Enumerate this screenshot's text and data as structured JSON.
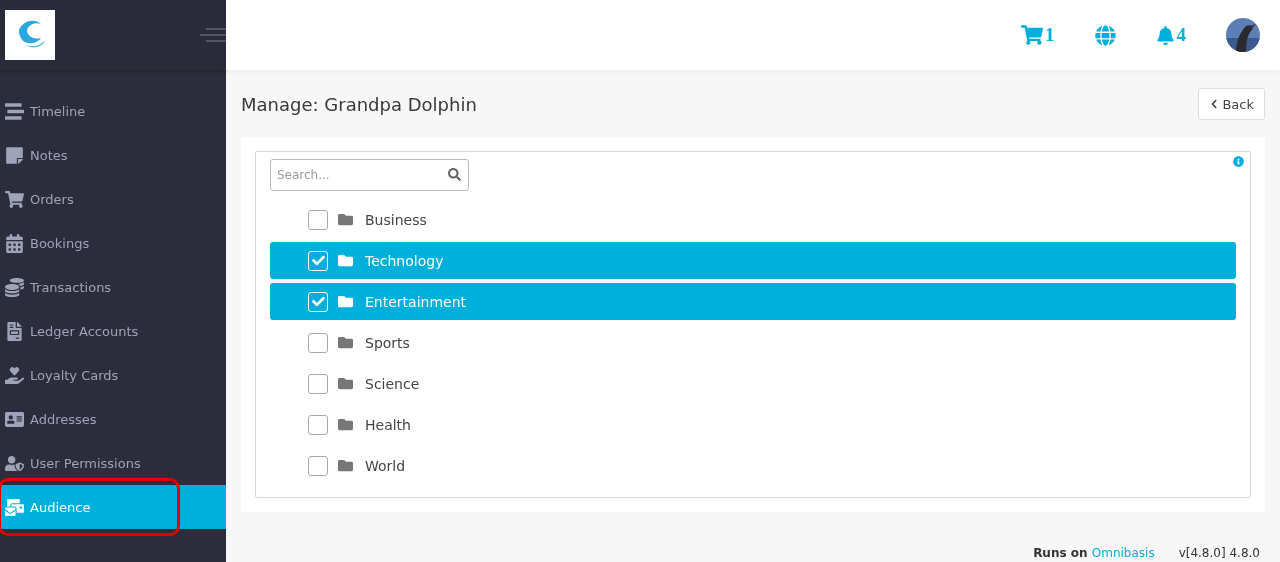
{
  "sidebar": {
    "items": [
      {
        "kind": "timeline",
        "label": "Timeline",
        "selected": false
      },
      {
        "kind": "notes",
        "label": "Notes",
        "selected": false
      },
      {
        "kind": "orders",
        "label": "Orders",
        "selected": false
      },
      {
        "kind": "bookings",
        "label": "Bookings",
        "selected": false
      },
      {
        "kind": "transactions",
        "label": "Transactions",
        "selected": false
      },
      {
        "kind": "ledger",
        "label": "Ledger Accounts",
        "selected": false
      },
      {
        "kind": "loyalty",
        "label": "Loyalty Cards",
        "selected": false
      },
      {
        "kind": "addresses",
        "label": "Addresses",
        "selected": false
      },
      {
        "kind": "permissions",
        "label": "User Permissions",
        "selected": false
      },
      {
        "kind": "audience",
        "label": "Audience",
        "selected": true
      }
    ]
  },
  "header": {
    "cart_count": "1",
    "notification_count": "4"
  },
  "page": {
    "title": "Manage: Grandpa Dolphin",
    "back_button": "Back"
  },
  "search": {
    "placeholder": "Search..."
  },
  "categories": [
    {
      "label": "Business",
      "checked": false
    },
    {
      "label": "Technology",
      "checked": true
    },
    {
      "label": "Entertainment",
      "checked": true
    },
    {
      "label": "Sports",
      "checked": false
    },
    {
      "label": "Science",
      "checked": false
    },
    {
      "label": "Health",
      "checked": false
    },
    {
      "label": "World",
      "checked": false
    }
  ],
  "footer": {
    "runs_on": "Runs on",
    "brand": "Omnibasis",
    "version": "v[4.8.0] 4.8.0"
  }
}
